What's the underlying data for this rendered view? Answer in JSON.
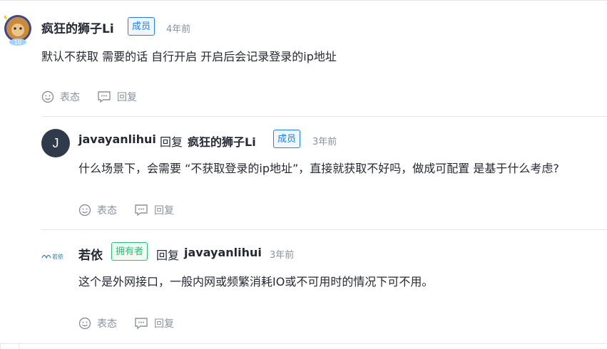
{
  "comments": [
    {
      "author": "疯狂的狮子Li",
      "badge": "成员",
      "time": "4年前",
      "content": "默认不获取 需要的话 自行开启 开启后会记录登录的ip地址",
      "level": "10",
      "actions": {
        "react": "表态",
        "reply": "回复"
      }
    },
    {
      "author": "javayanlihui",
      "avatar_letter": "J",
      "reply_word": "回复",
      "reply_to": "疯狂的狮子Li",
      "badge": "成员",
      "time": "3年前",
      "content": "什么场景下，会需要 “不获取登录的ip地址”，直接就获取不好吗，做成可配置 是基于什么考虑?",
      "actions": {
        "react": "表态",
        "reply": "回复"
      }
    },
    {
      "author": "若依",
      "avatar_text": "若依",
      "badge": "拥有者",
      "reply_word": "回复",
      "reply_to": "javayanlihui",
      "time": "3年前",
      "content": "这个是外网接口，一般内网或频繁消耗IO或不可用时的情况下可不用。",
      "actions": {
        "react": "表态",
        "reply": "回复"
      }
    }
  ],
  "colors": {
    "accent": "#1e80ff",
    "owner": "#2fbf71",
    "muted": "#8a919f",
    "text": "#252933"
  }
}
